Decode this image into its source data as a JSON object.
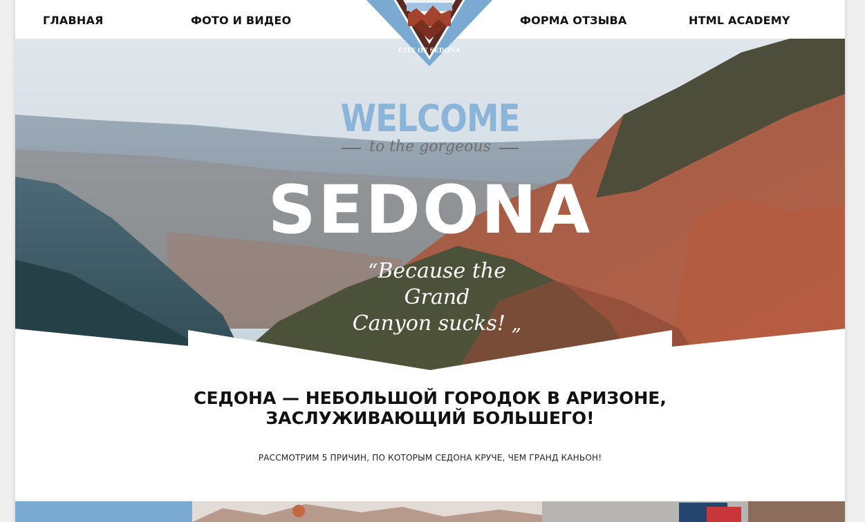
{
  "nav": {
    "items": [
      {
        "label": "ГЛАВНАЯ"
      },
      {
        "label": "ФОТО И ВИДЕО"
      },
      {
        "label": "ФОРМА ОТЗЫВА"
      },
      {
        "label": "HTML ACADEMY"
      }
    ]
  },
  "logo": {
    "text": "CITY OF SEDONA"
  },
  "hero": {
    "welcome": "WELCOME",
    "tagline": "to the gorgeous",
    "title": "SEDONA",
    "quote_line1": "Because the Grand",
    "quote_line2": "Canyon sucks!"
  },
  "main": {
    "headline_line1": "СЕДОНА — НЕБОЛЬШОЙ ГОРОДОК В АРИЗОНЕ,",
    "headline_line2": "ЗАСЛУЖИВАЮЩИЙ БОЛЬШЕГО!",
    "subtitle": "РАССМОТРИМ 5 ПРИЧИН, ПО КОТОРЫМ СЕДОНА КРУЧЕ, ЧЕМ ГРАНД КАНЬОН!"
  },
  "colors": {
    "accent_blue": "#7aa9d2",
    "logo_brown": "#6b2a1e",
    "text": "#111111"
  }
}
